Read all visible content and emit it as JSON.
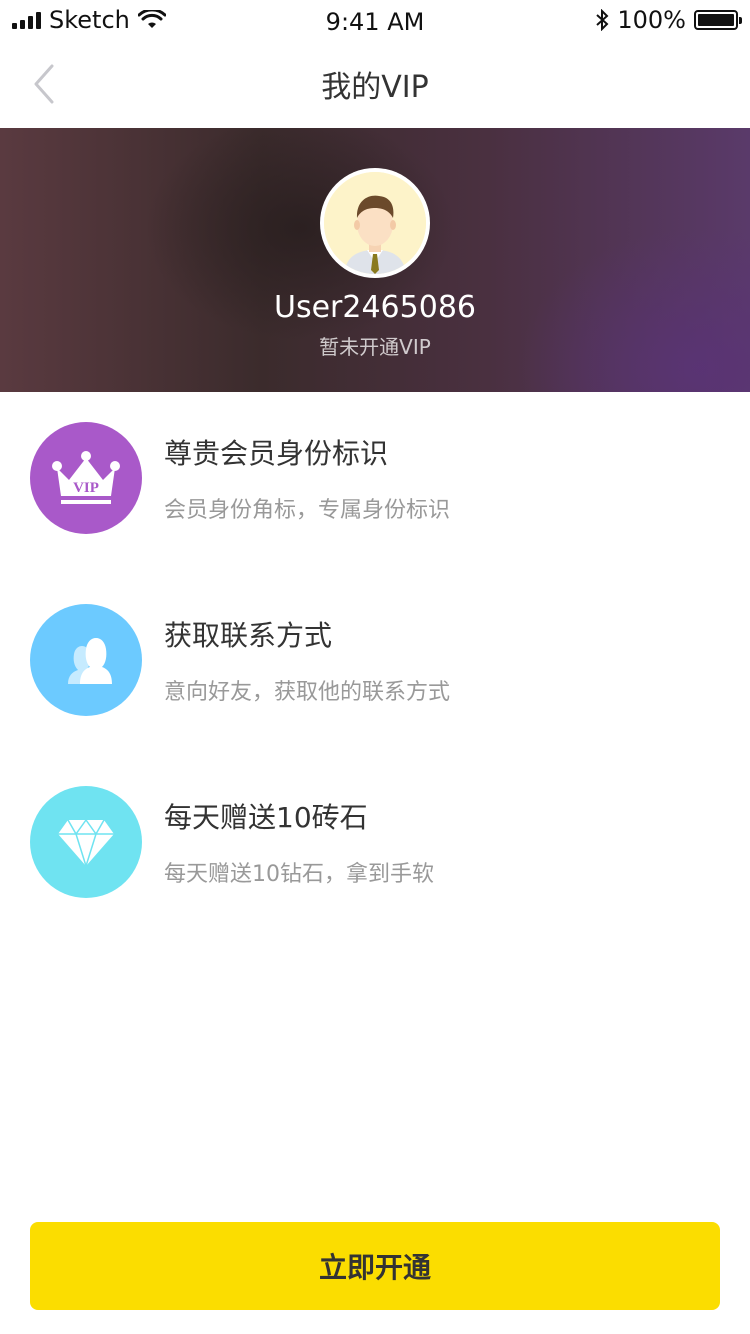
{
  "status_bar": {
    "carrier": "Sketch",
    "time": "9:41 AM",
    "battery": "100%",
    "battery_level": 1.0
  },
  "nav": {
    "title": "我的VIP",
    "back_icon": "chevron-left-icon"
  },
  "profile": {
    "username": "User2465086",
    "vip_status": "暂未开通VIP"
  },
  "benefits": [
    {
      "icon": "vip-crown-icon",
      "color": "#a959c9",
      "title": "尊贵会员身份标识",
      "desc": "会员身份角标，专属身份标识"
    },
    {
      "icon": "contacts-icon",
      "color": "#6ccaff",
      "title": "获取联系方式",
      "desc": "意向好友，获取他的联系方式"
    },
    {
      "icon": "diamond-icon",
      "color": "#6fe3f1",
      "title": "每天赠送10砖石",
      "desc": "每天赠送10钻石，拿到手软"
    }
  ],
  "vip_badge_text": "VIP",
  "action": {
    "label": "立即开通",
    "color": "#fbdd00"
  }
}
